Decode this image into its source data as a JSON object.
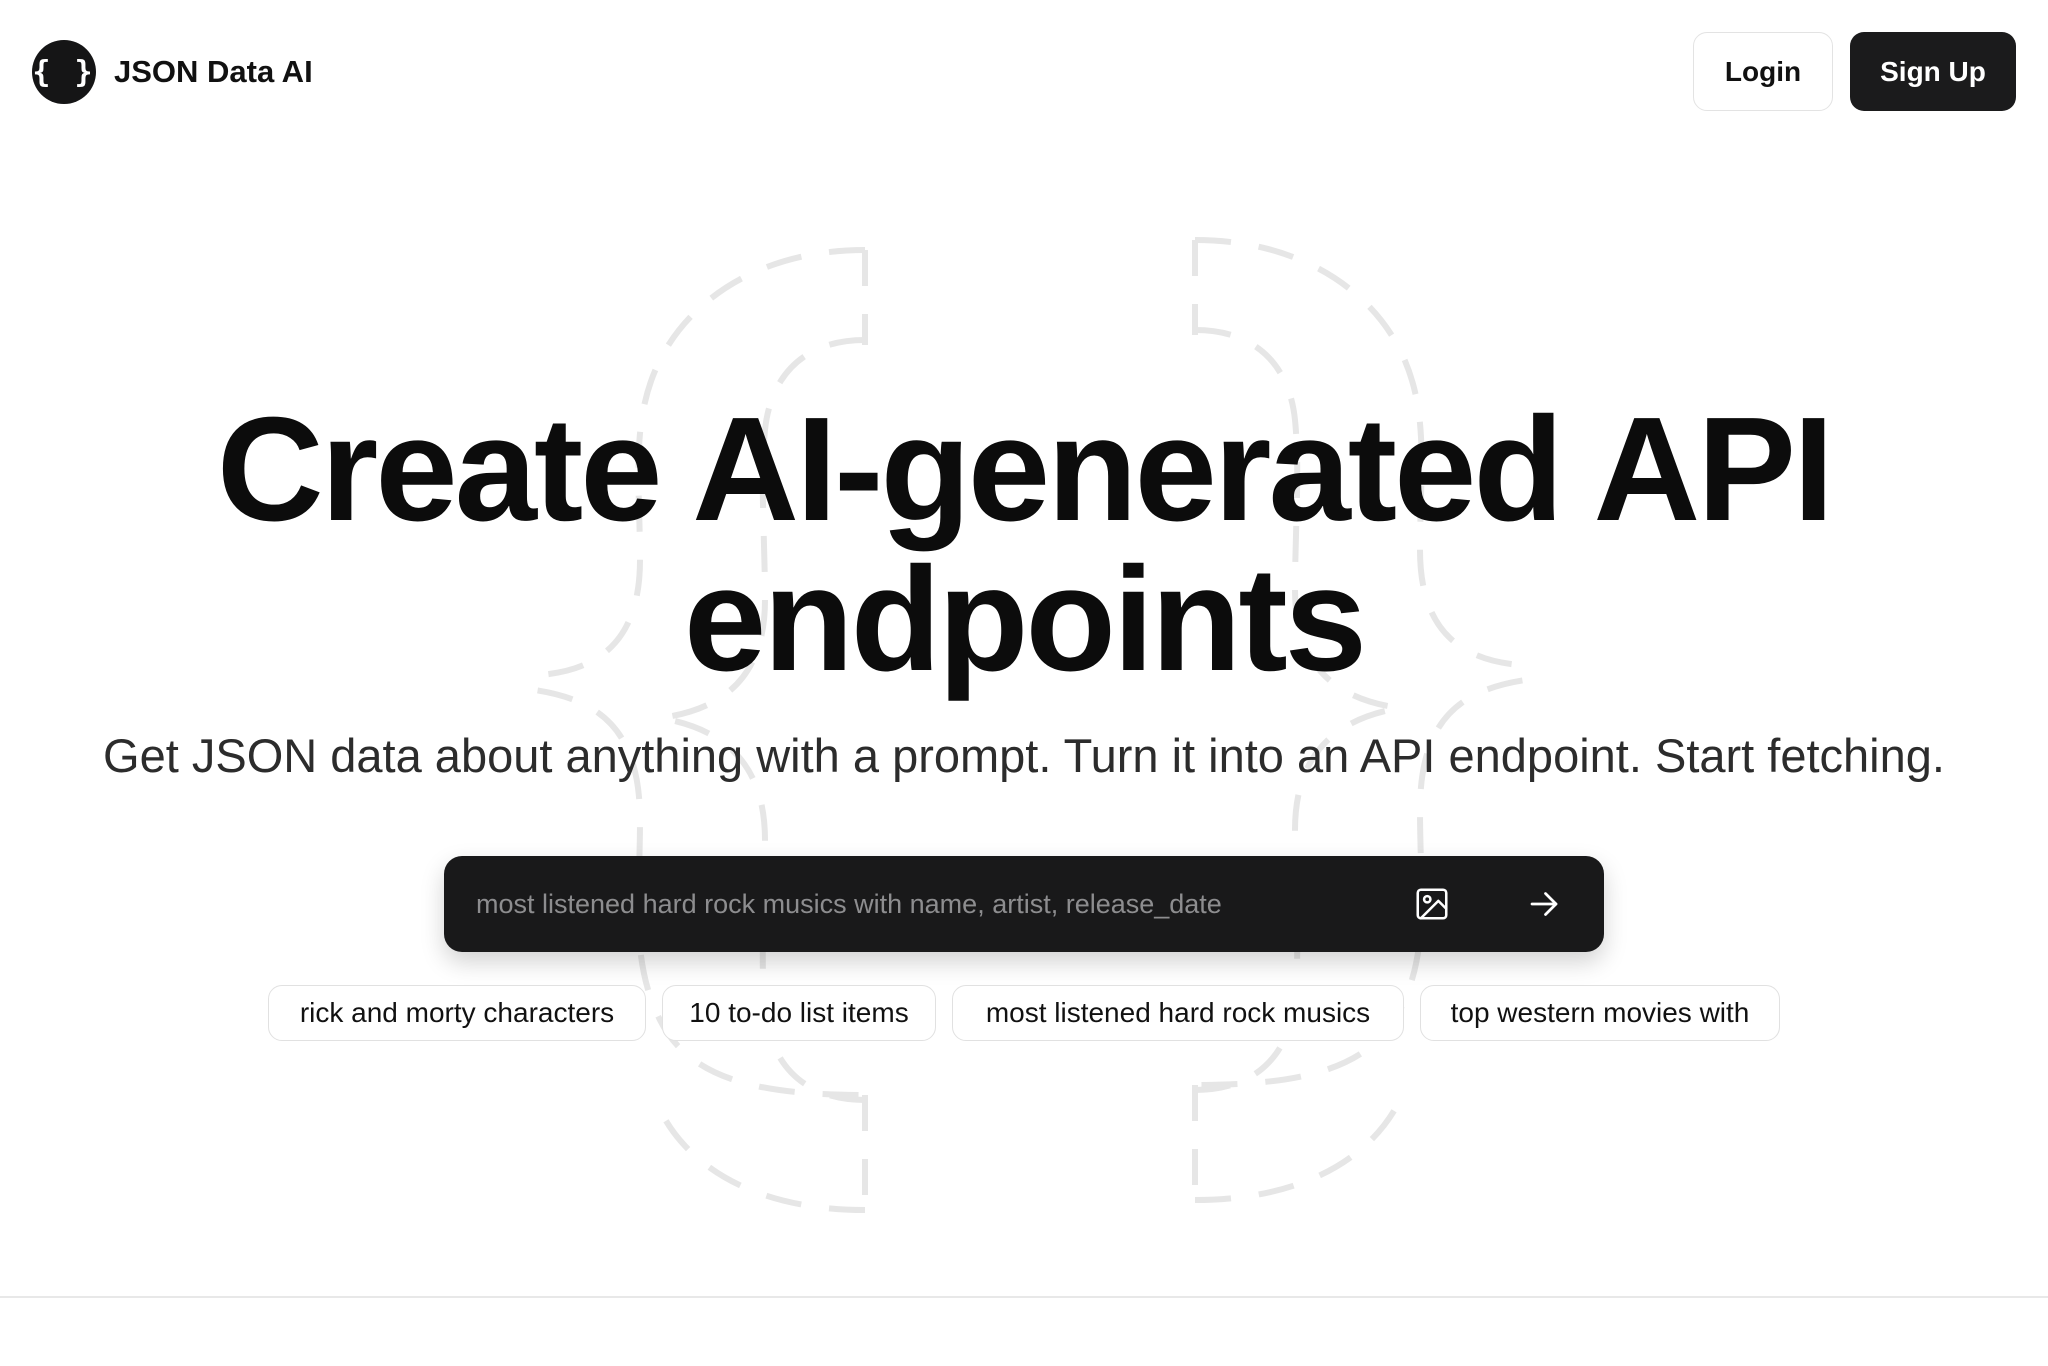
{
  "brand": {
    "logo_glyph": "{ }",
    "name": "JSON Data AI"
  },
  "nav": {
    "login_label": "Login",
    "signup_label": "Sign Up"
  },
  "hero": {
    "title_line1": "Create AI-generated API",
    "title_line2": "endpoints",
    "subtitle": "Get JSON data about anything with a prompt. Turn it into an API endpoint. Start fetching."
  },
  "prompt": {
    "placeholder": "most listened hard rock musics with name, artist, release_date",
    "value": "",
    "image_icon": "image-icon",
    "submit_icon": "arrow-right-icon"
  },
  "suggestions": [
    "rick and morty characters",
    "10 to-do list items",
    "most listened hard rock musics",
    "top western movies with"
  ],
  "colors": {
    "background": "#ffffff",
    "primary_dark": "#1b1b1c",
    "text": "#111111",
    "muted_text": "#8d8d8f",
    "border": "#e3e3e3",
    "decor_dash": "#e6e6e6"
  }
}
